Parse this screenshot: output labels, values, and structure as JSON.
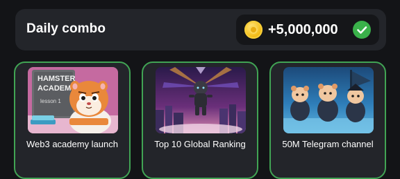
{
  "combo": {
    "title": "Daily combo",
    "reward": "+5,000,000",
    "coin_icon": "coin-icon",
    "status_icon": "checkmark-icon",
    "status_color": "#3ab14a"
  },
  "cards": [
    {
      "label": "Web3 academy launch",
      "image_text_1": "HAMSTER",
      "image_text_2": "ACADEMY",
      "image_text_3": "lesson 1"
    },
    {
      "label": "Top 10 Global Ranking"
    },
    {
      "label": "50M Telegram channel"
    }
  ],
  "colors": {
    "background": "#131417",
    "panel": "#23252a",
    "card_border": "#41a454"
  }
}
